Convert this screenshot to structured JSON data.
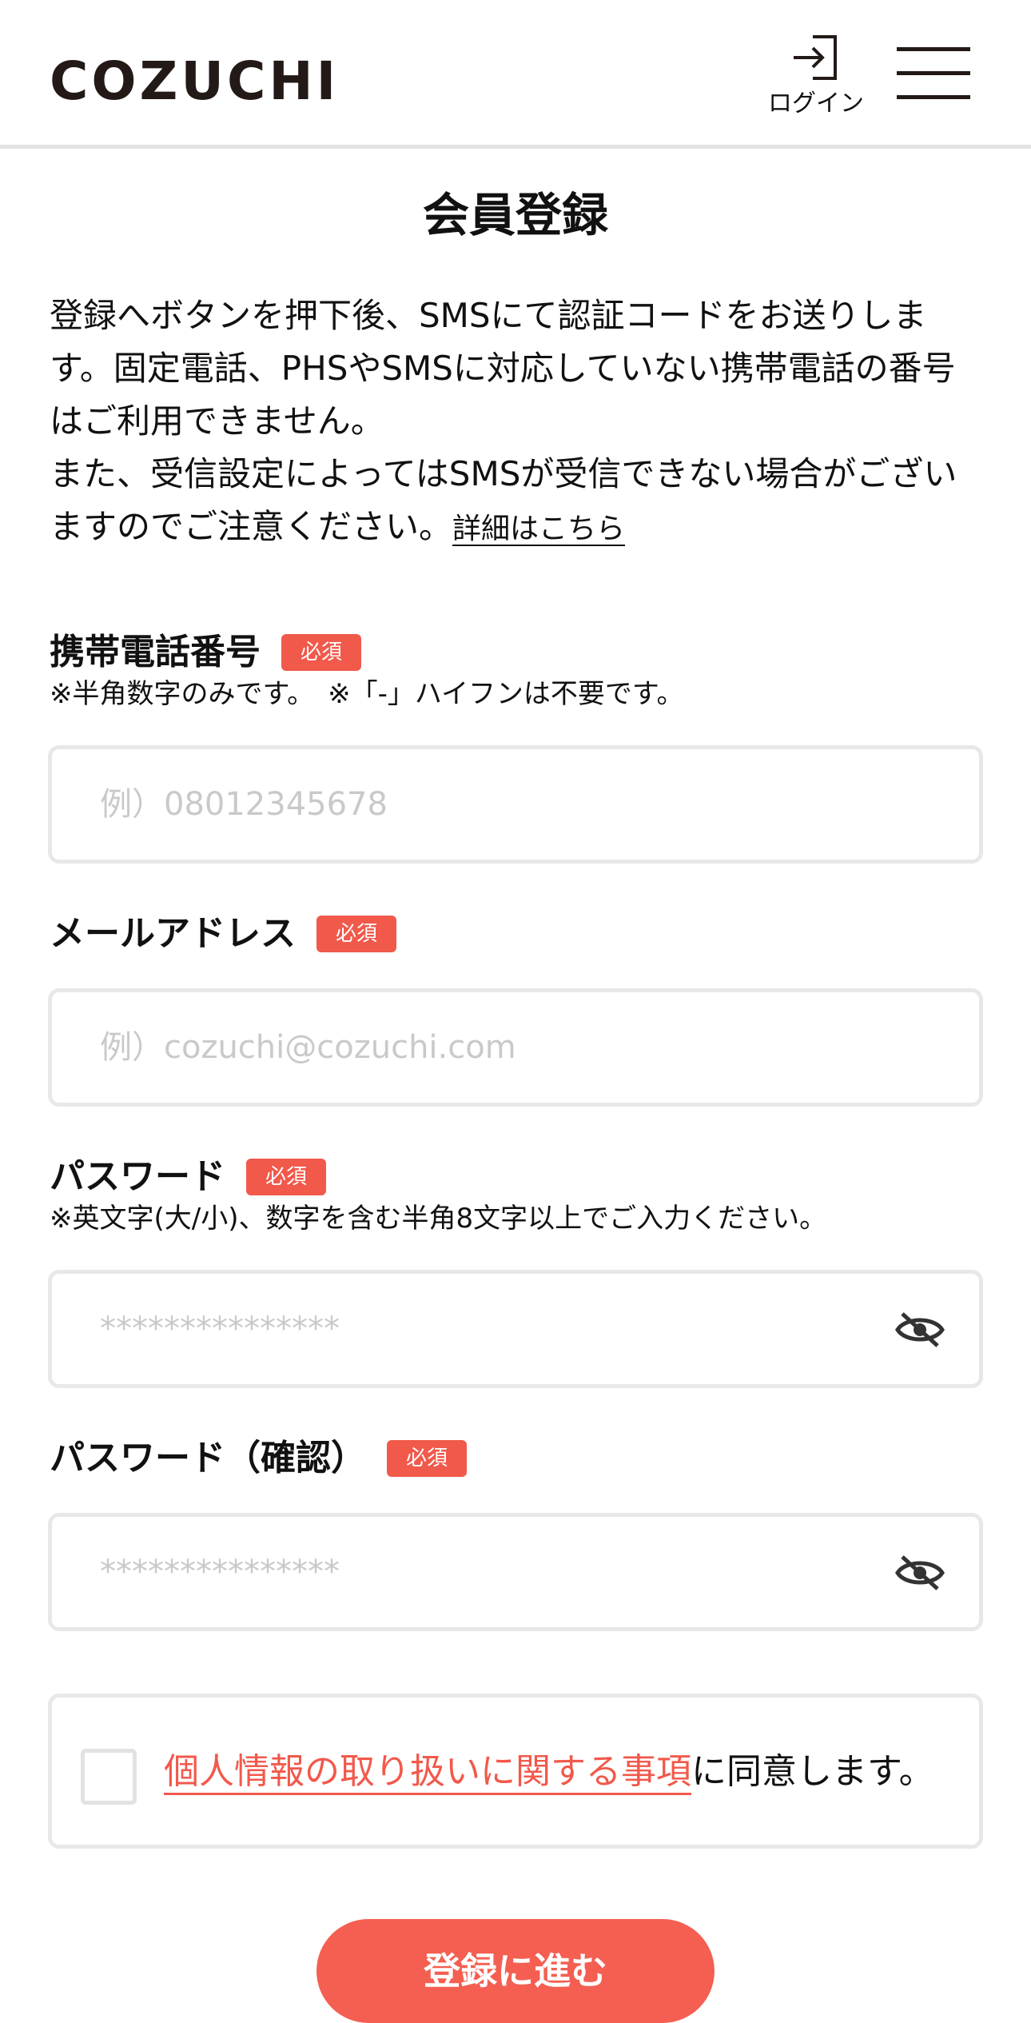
{
  "header": {
    "logo": "COZUCHI",
    "login_label": "ログイン"
  },
  "page_title": "会員登録",
  "intro": {
    "paragraph1": "登録へボタンを押下後、SMSにて認証コードをお送りします。固定電話、PHSやSMSに対応していない携帯電話の番号はご利用できません。",
    "paragraph2": "また、受信設定によってはSMSが受信できない場合がございますのでご注意ください。",
    "detail_link": "詳細はこちら"
  },
  "required_badge": "必須",
  "fields": {
    "phone": {
      "label": "携帯電話番号",
      "note": "※半角数字のみです。　※「-」ハイフンは不要です。",
      "placeholder": "例）08012345678"
    },
    "email": {
      "label": "メールアドレス",
      "placeholder": "例）cozuchi@cozuchi.com"
    },
    "password": {
      "label": "パスワード",
      "note": "※英文字(大/小)、数字を含む半角8文字以上でご入力ください。",
      "placeholder": "***************"
    },
    "password_confirm": {
      "label": "パスワード（確認）",
      "placeholder": "***************"
    }
  },
  "agreement": {
    "link_text": "個人情報の取り扱いに関する事項",
    "suffix": "に同意します。",
    "checked": false
  },
  "submit_label": "登録に進む",
  "colors": {
    "accent": "#f1594b",
    "border": "#e8e8e8",
    "placeholder": "#c9c9c9",
    "text": "#111111"
  }
}
